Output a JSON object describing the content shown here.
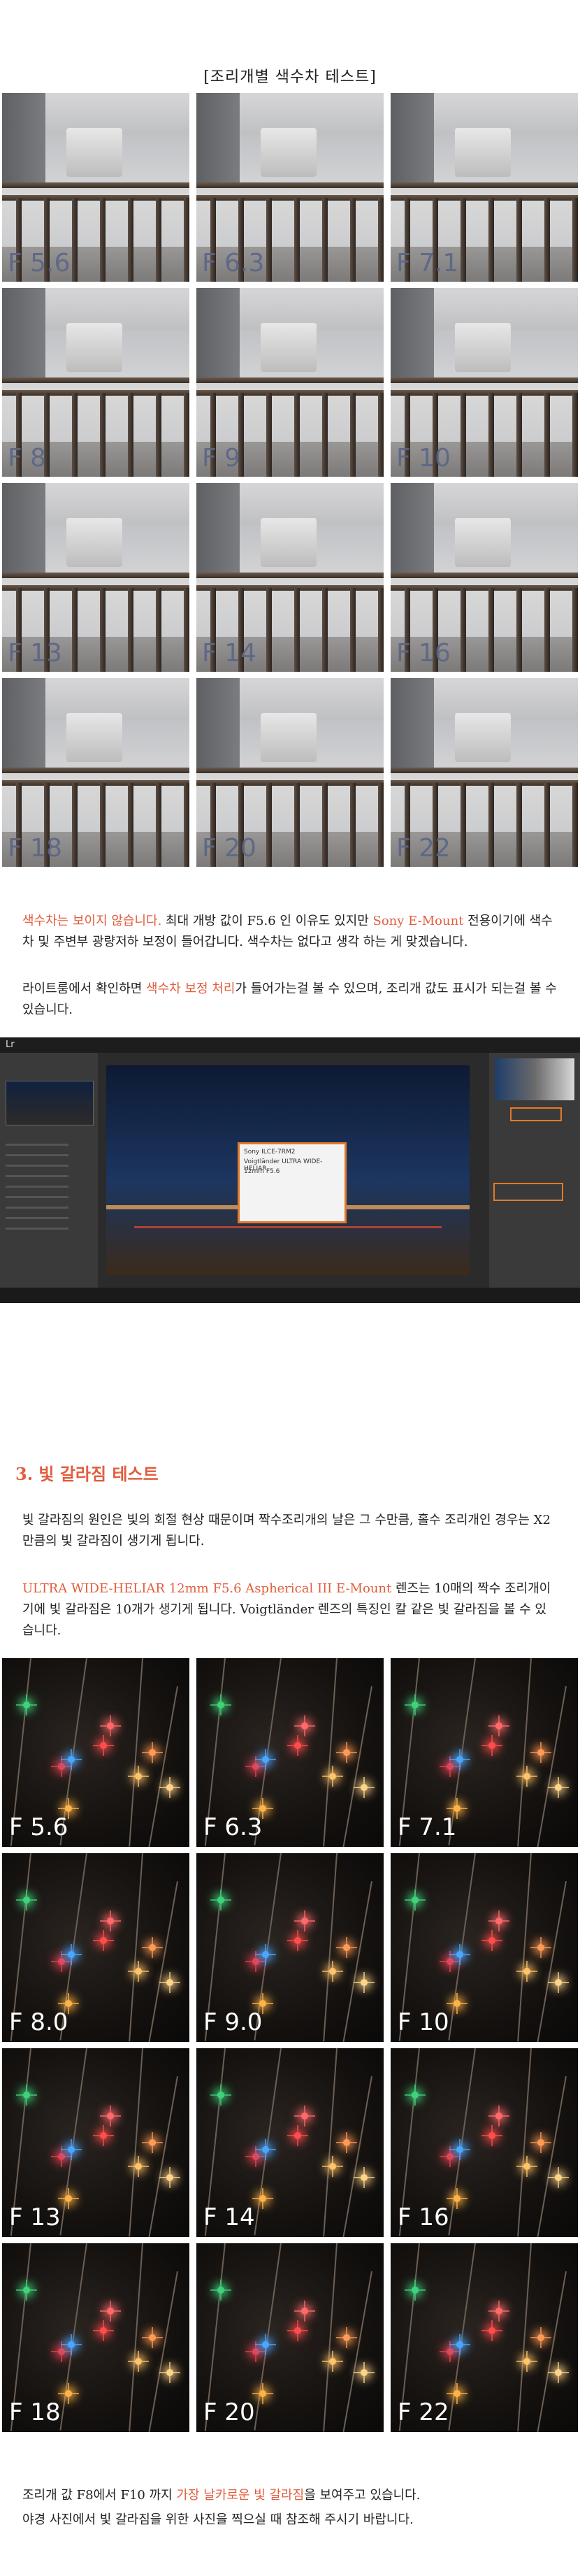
{
  "ca_test": {
    "title": "[조리개별 색수차 테스트]",
    "labels": [
      "F 5.6",
      "F 6.3",
      "F 7.1",
      "F 8",
      "F 9",
      "F 10",
      "F 13",
      "F 14",
      "F 16",
      "F 18",
      "F 20",
      "F 22"
    ]
  },
  "ca_text": {
    "red_1": "색수차는 보이지 않습니다.",
    "plain_1": " 최대 개방 값이 F5.6 인 이유도 있지만 ",
    "red_2": "Sony E-Mount",
    "plain_2": " 전용이기에 색수차 및 주변부 광량저하 보정이 들어갑니다. 색수차는 없다고 생각 하는 게 맞겠습니다.",
    "line2_a": "라이트룸에서 확인하면 ",
    "line2_red": "색수차 보정 처리",
    "line2_b": "가 들어가는걸 볼 수 있으며, 조리개 값도 표시가 되는걸 볼 수 있습니다."
  },
  "lightroom": {
    "dialog_lines": [
      "Sony ILCE-7RM2",
      "Voigtländer ULTRA WIDE-HELIAR",
      "12mm F5.6"
    ],
    "logo": "Lr"
  },
  "star_section": {
    "heading": "3. 빛 갈라짐 테스트",
    "para1": "빛 갈라짐의 원인은 빛의 회절 현상 때문이며 짝수조리개의 날은 그 수만큼, 홀수 조리개인 경우는 X2 만큼의 빛 갈라짐이 생기게 됩니다.",
    "para2_red": "ULTRA WIDE-HELIAR 12mm F5.6 Aspherical III E-Mount",
    "para2_rest": " 렌즈는 10매의 짝수 조리개이기에 빛 갈라짐은 10개가 생기게 됩니다. Voigtländer 렌즈의 특징인 칼 같은 빛 갈라짐을 볼 수 있습니다.",
    "labels": [
      "F 5.6",
      "F 6.3",
      "F 7.1",
      "F 8.0",
      "F 9.0",
      "F 10",
      "F 13",
      "F 14",
      "F 16",
      "F 18",
      "F 20",
      "F 22"
    ]
  },
  "footer": {
    "line1_a": "조리개 값 F8에서 F10 까지 ",
    "line1_red": "가장 날카로운 빛 갈라짐",
    "line1_b": "을 보여주고 있습니다.",
    "line2": "야경 사진에서 빛 갈라짐을 위한 사진을 찍으실 때 참조해 주시기 바랍니다."
  }
}
